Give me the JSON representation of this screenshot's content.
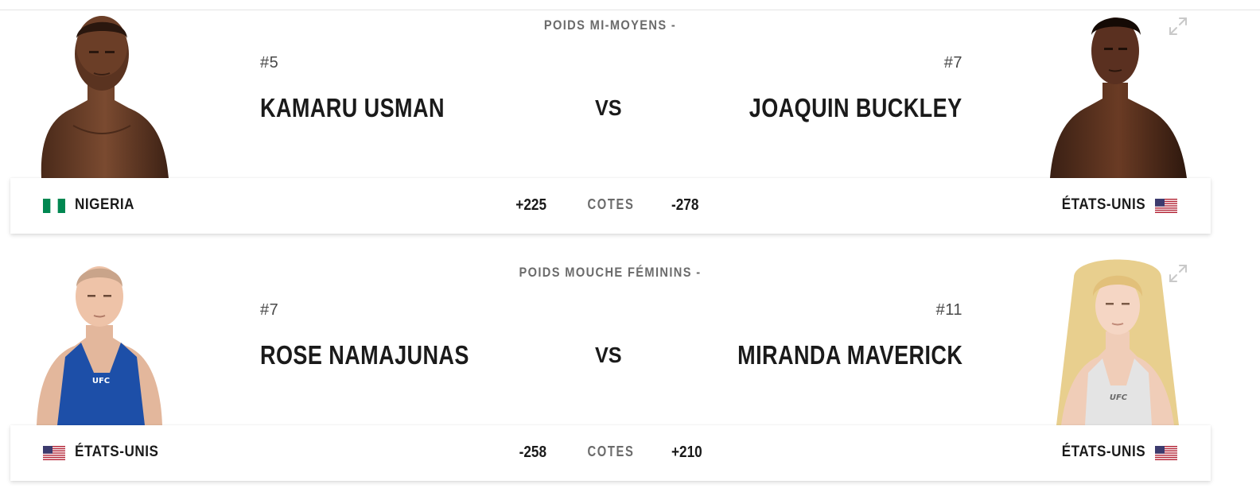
{
  "fights": [
    {
      "weight_class": "POIDS MI-MOYENS -",
      "red": {
        "rank": "#5",
        "name": "KAMARU USMAN",
        "country": "NIGERIA",
        "flag": "nigeria-flag-icon",
        "odds": "+225"
      },
      "vs_label": "VS",
      "odds_label": "COTES",
      "blue": {
        "rank": "#7",
        "name": "JOAQUIN BUCKLEY",
        "country": "ÉTATS-UNIS",
        "flag": "usa-flag-icon",
        "odds": "-278"
      }
    },
    {
      "weight_class": "POIDS MOUCHE FÉMININS -",
      "red": {
        "rank": "#7",
        "name": "ROSE NAMAJUNAS",
        "country": "ÉTATS-UNIS",
        "flag": "usa-flag-icon",
        "odds": "-258"
      },
      "vs_label": "VS",
      "odds_label": "COTES",
      "blue": {
        "rank": "#11",
        "name": "MIRANDA MAVERICK",
        "country": "ÉTATS-UNIS",
        "flag": "usa-flag-icon",
        "odds": "+210"
      }
    }
  ],
  "icons": {
    "expand": "expand-icon"
  },
  "colors": {
    "text": "#191919",
    "muted": "#6b6b6b",
    "nigeria_green": "#008751",
    "usa_red": "#b22234",
    "usa_blue": "#3c3b6e"
  },
  "jersey_text": "UFC"
}
